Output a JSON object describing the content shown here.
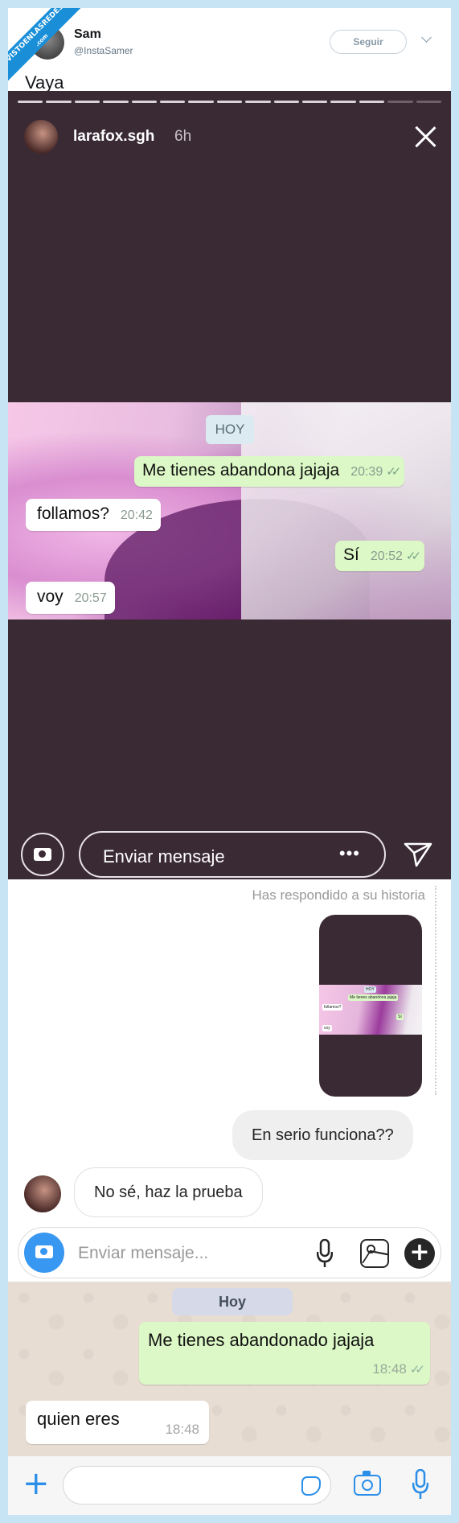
{
  "badge": {
    "line1": "VISTOENLASREDES",
    "line2": ".com"
  },
  "tweet": {
    "name": "Sam",
    "handle": "@InstaSamer",
    "follow_label": "Seguir",
    "text": "Vaya"
  },
  "story": {
    "username": "larafox.sgh",
    "time": "6h",
    "progress_segments": 15,
    "progress_viewed": 13,
    "whatsapp": {
      "date": "HOY",
      "messages": [
        {
          "dir": "out",
          "text": "Me tienes abandona jajaja",
          "time": "20:39",
          "ticks": "✓✓"
        },
        {
          "dir": "in",
          "text": "follamos?",
          "time": "20:42"
        },
        {
          "dir": "out",
          "text": "Sí",
          "time": "20:52",
          "ticks": "✓✓"
        },
        {
          "dir": "in",
          "text": "voy",
          "time": "20:57"
        }
      ]
    },
    "reply_placeholder": "Enviar mensaje",
    "more_label": "•••"
  },
  "dm": {
    "replied_label": "Has respondido a su historia",
    "messages": [
      {
        "dir": "out",
        "text": "En serio funciona??"
      },
      {
        "dir": "in",
        "text": "No sé, haz la prueba"
      }
    ],
    "placeholder": "Enviar mensaje...",
    "plus_label": "+"
  },
  "whatsapp": {
    "date": "Hoy",
    "messages": [
      {
        "dir": "out",
        "text": "Me tienes abandonado jajaja",
        "time": "18:48",
        "ticks": "✓✓"
      },
      {
        "dir": "in",
        "text": "quien eres",
        "time": "18:48"
      }
    ],
    "plus_label": "+"
  },
  "colors": {
    "story_bg": "#3a2a34",
    "wa_out_bubble": "#dcf8c6",
    "ig_blue": "#3897f0",
    "wa_blue": "#2b8ee8",
    "page_bg": "#c7e4f5"
  }
}
